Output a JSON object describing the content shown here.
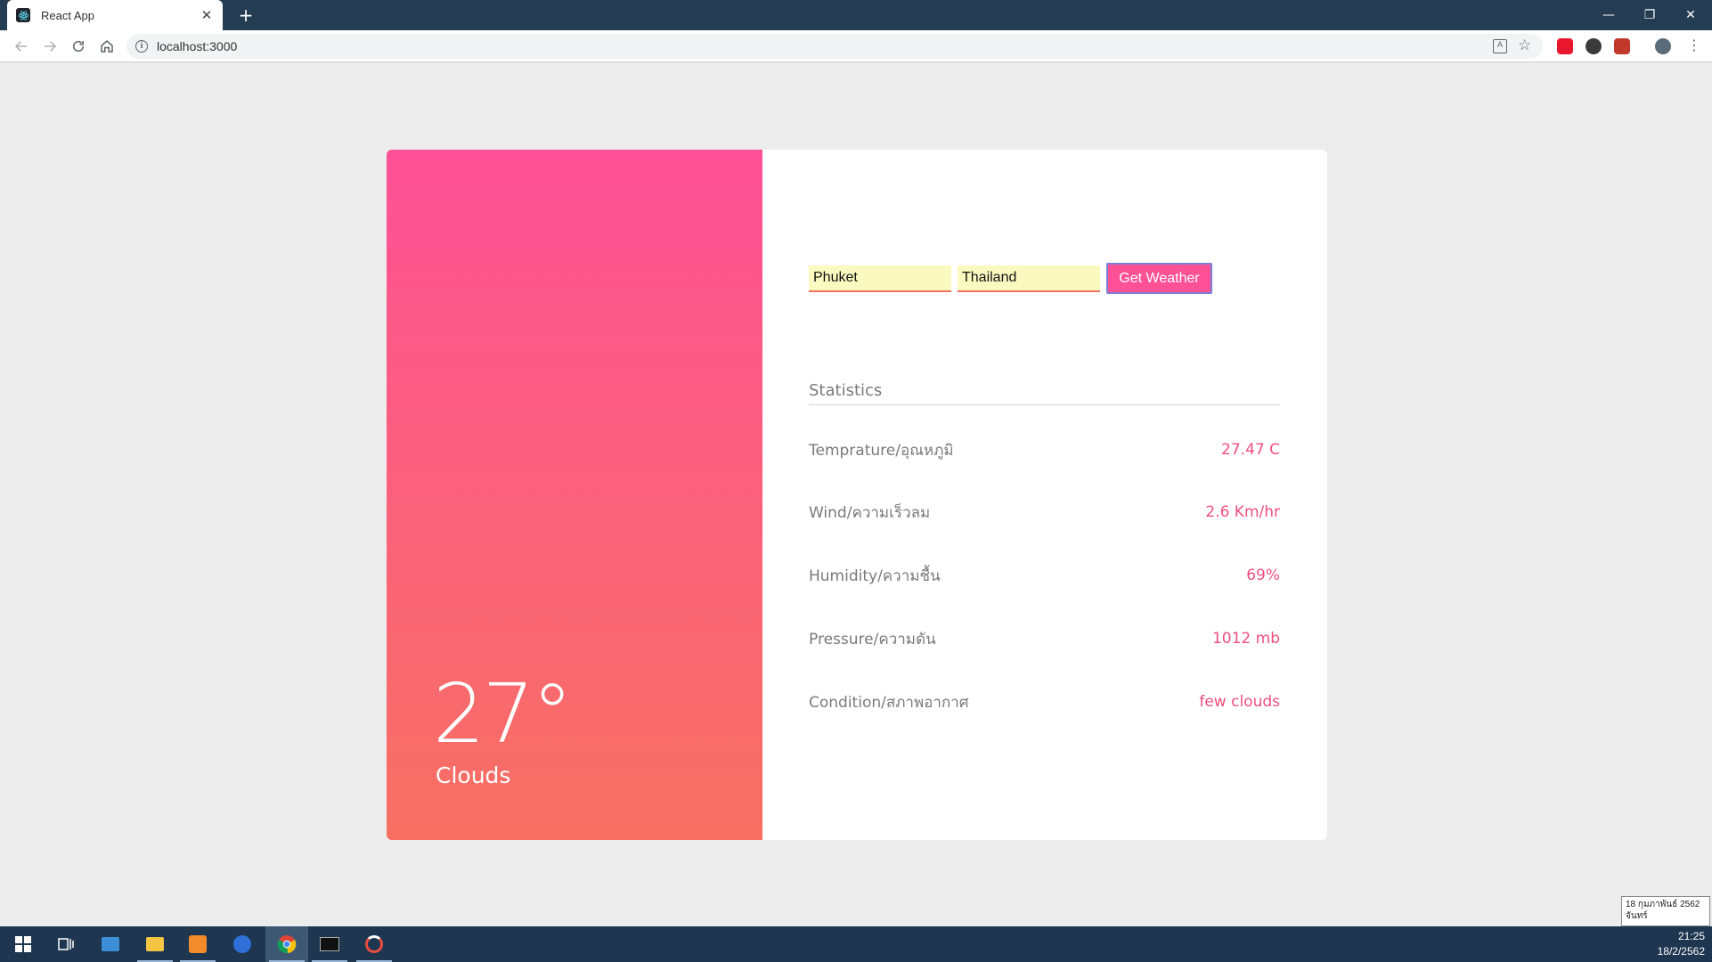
{
  "browser": {
    "tab_title": "React App",
    "url": "localhost:3000"
  },
  "weather": {
    "temperature_display": "27°",
    "condition": "Clouds"
  },
  "form": {
    "city_value": "Phuket",
    "country_value": "Thailand",
    "button_label": "Get Weather"
  },
  "statistics": {
    "title": "Statistics",
    "rows": [
      {
        "label": "Temprature/อุณหภูมิ",
        "value": "27.47 C"
      },
      {
        "label": "Wind/ความเร็วลม",
        "value": "2.6 Km/hr"
      },
      {
        "label": "Humidity/ความชื้น",
        "value": "69%"
      },
      {
        "label": "Pressure/ความดัน",
        "value": "1012 mb"
      },
      {
        "label": "Condition/สภาพอากาศ",
        "value": "few clouds"
      }
    ]
  },
  "taskbar": {
    "tooltip_date": "18 กุมภาพันธ์ 2562",
    "tooltip_day": "จันทร์",
    "time": "21:25",
    "date": "18/2/2562"
  },
  "colors": {
    "gradient_top": "#fe5196",
    "gradient_bottom": "#f77062",
    "value_accent": "#ef4f7e",
    "input_bg": "#fafac0"
  }
}
